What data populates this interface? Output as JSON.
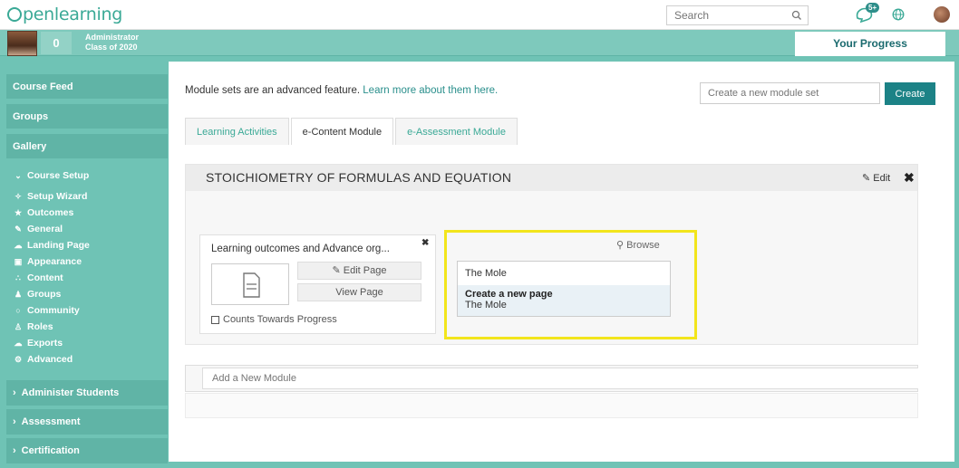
{
  "header": {
    "logo_text": "penlearning",
    "search_placeholder": "Search",
    "notification_badge": "5+"
  },
  "user": {
    "count": "0",
    "role_line1": "Administrator",
    "role_line2": "Class of 2020",
    "progress_label": "Your Progress"
  },
  "sidebar": {
    "top_items": [
      "Course Feed",
      "Groups",
      "Gallery"
    ],
    "setup_label": "Course Setup",
    "setup_items": [
      {
        "label": "Setup Wizard",
        "icon": "wand-icon"
      },
      {
        "label": "Outcomes",
        "icon": "star-icon"
      },
      {
        "label": "General",
        "icon": "edit-icon"
      },
      {
        "label": "Landing Page",
        "icon": "cloud-icon"
      },
      {
        "label": "Appearance",
        "icon": "image-icon"
      },
      {
        "label": "Content",
        "icon": "sitemap-icon"
      },
      {
        "label": "Groups",
        "icon": "users-icon"
      },
      {
        "label": "Community",
        "icon": "chat-icon"
      },
      {
        "label": "Roles",
        "icon": "user-icon"
      },
      {
        "label": "Exports",
        "icon": "export-icon"
      },
      {
        "label": "Advanced",
        "icon": "cogs-icon"
      }
    ],
    "bottom_items": [
      "Administer Students",
      "Assessment",
      "Certification"
    ]
  },
  "main": {
    "intro_text": "Module sets are an advanced feature.",
    "intro_link": "Learn more about them here.",
    "new_set_placeholder": "Create a new module set",
    "create_label": "Create",
    "tabs": [
      "Learning Activities",
      "e-Content Module",
      "e-Assessment Module"
    ],
    "active_tab": "e-Content Module"
  },
  "module": {
    "title": "STOICHIOMETRY OF FORMULAS AND EQUATION",
    "edit_label": "Edit",
    "activity": {
      "title": "Learning outcomes and Advance org...",
      "edit_page_label": "Edit Page",
      "view_page_label": "View Page",
      "counts_label": "Counts Towards Progress"
    },
    "lookup": {
      "browse_label": "Browse",
      "input_value": "The Mole",
      "suggest_title": "Create a new page",
      "suggest_sub": "The Mole"
    },
    "add_placeholder": "Add a New Module"
  },
  "colors": {
    "accent": "#3aa996",
    "sidebar": "#6fc3b5",
    "button": "#1c8286",
    "highlight": "#f2e51c"
  }
}
